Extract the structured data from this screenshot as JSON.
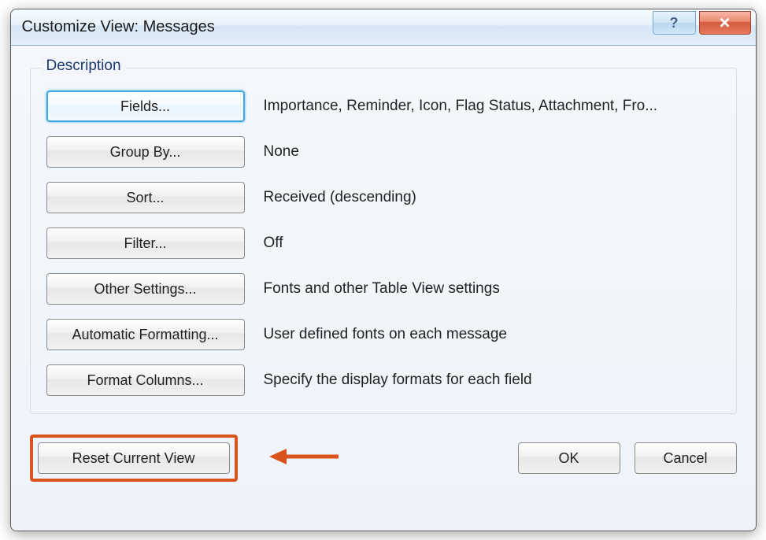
{
  "title": "Customize View: Messages",
  "group_label": "Description",
  "rows": [
    {
      "button": "Fields...",
      "desc": "Importance, Reminder, Icon, Flag Status, Attachment, Fro..."
    },
    {
      "button": "Group By...",
      "desc": "None"
    },
    {
      "button": "Sort...",
      "desc": "Received (descending)"
    },
    {
      "button": "Filter...",
      "desc": "Off"
    },
    {
      "button": "Other Settings...",
      "desc": "Fonts and other Table View settings"
    },
    {
      "button": "Automatic Formatting...",
      "desc": "User defined fonts on each message"
    },
    {
      "button": "Format Columns...",
      "desc": "Specify the display formats for each field"
    }
  ],
  "reset_label": "Reset Current View",
  "ok_label": "OK",
  "cancel_label": "Cancel"
}
